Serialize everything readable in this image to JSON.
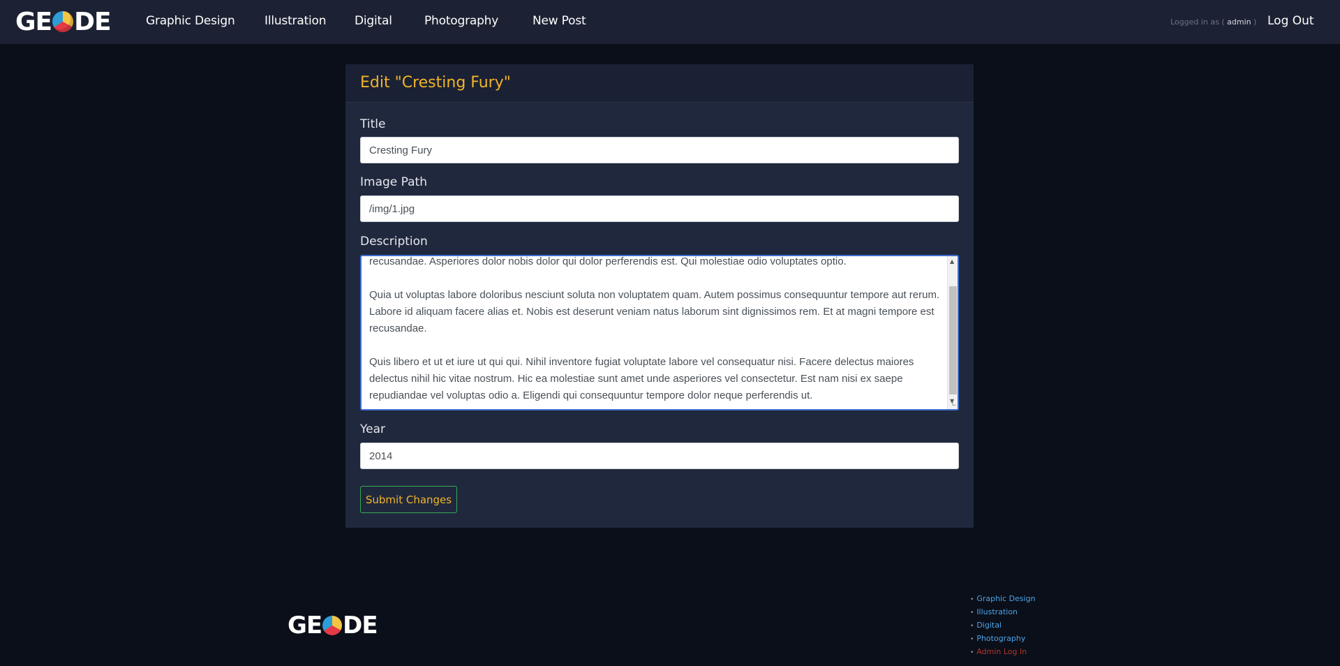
{
  "nav": {
    "logo_left": "GE",
    "logo_right": "DE",
    "links": [
      "Graphic Design",
      "Illustration",
      "Digital",
      "Photography",
      "New Post"
    ],
    "logged_in_prefix": "Logged in as (",
    "logged_in_user": "admin",
    "logged_in_suffix": ")",
    "logout": "Log Out"
  },
  "form": {
    "heading": "Edit \"Cresting Fury\"",
    "title_label": "Title",
    "title_value": "Cresting Fury",
    "image_label": "Image Path",
    "image_value": "/img/1.jpg",
    "description_label": "Description",
    "description_paragraphs": [
      "recusandae. Asperiores dolor nobis dolor qui dolor perferendis est. Qui molestiae odio voluptates optio.",
      "Quia ut voluptas labore doloribus nesciunt soluta non voluptatem quam. Autem possimus consequuntur tempore aut rerum. Labore id aliquam facere alias et. Nobis est deserunt veniam natus laborum sint dignissimos rem. Et at magni tempore est recusandae.",
      "Quis libero et ut et iure ut qui qui. Nihil inventore fugiat voluptate labore vel consequatur nisi. Facere delectus maiores delectus nihil hic vitae nostrum. Hic ea molestiae sunt amet unde asperiores vel consectetur. Est nam nisi ex saepe repudiandae vel voluptas odio a. Eligendi qui consequuntur tempore dolor neque perferendis ut."
    ],
    "year_label": "Year",
    "year_value": "2014",
    "submit_label": "Submit Changes"
  },
  "footer": {
    "logo_left": "GE",
    "logo_right": "DE",
    "links": [
      "Graphic Design",
      "Illustration",
      "Digital",
      "Photography"
    ],
    "admin_link": "Admin Log In"
  },
  "colors": {
    "page_bg": "#0b0f19",
    "nav_bg": "#1c2233",
    "card_bg": "#20283d",
    "accent": "#f0b429",
    "link": "#4da3e8",
    "admin_link": "#b0362d",
    "button_border": "#35a853"
  }
}
